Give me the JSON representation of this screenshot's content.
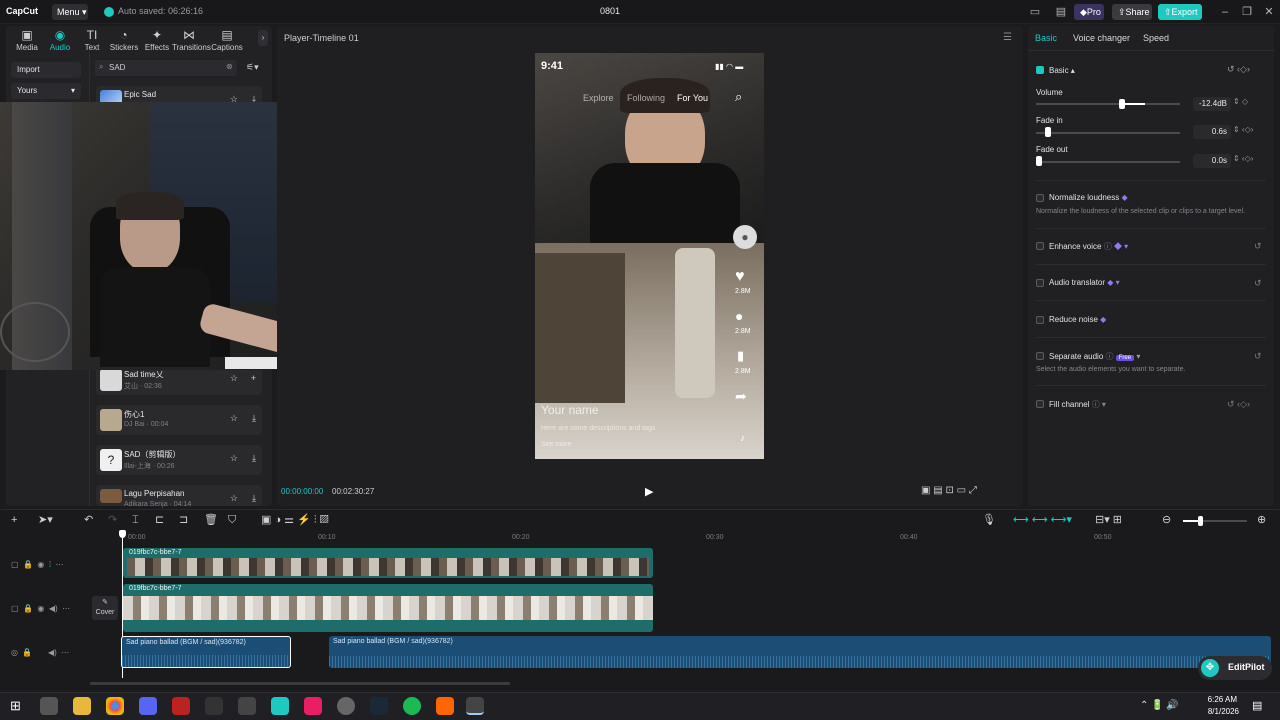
{
  "titlebar": {
    "logo": "CapCut",
    "menu": "Menu",
    "autosave": "Auto saved: 06:26:16",
    "project": "0801",
    "pro": "Pro",
    "share": "Share",
    "export": "Export"
  },
  "toolbar_tabs": [
    {
      "label": "Media",
      "icon": "▣"
    },
    {
      "label": "Audio",
      "icon": "◉"
    },
    {
      "label": "Text",
      "icon": "TI"
    },
    {
      "label": "Stickers",
      "icon": "◔"
    },
    {
      "label": "Effects",
      "icon": "✦"
    },
    {
      "label": "Transitions",
      "icon": "⋈"
    },
    {
      "label": "Captions",
      "icon": "▤"
    }
  ],
  "sidebar": {
    "import": "Import",
    "yours": "Yours"
  },
  "search": {
    "value": "SAD"
  },
  "tracks": [
    {
      "name": "Epic Sad",
      "sub": ""
    },
    {
      "name": "Sad time乂",
      "sub": "艾山 · 02:36"
    },
    {
      "name": "伤心1",
      "sub": "DJ Bai · 00:04"
    },
    {
      "name": "SAD（剪辑版）",
      "sub": "Illai-上海 · 00:26"
    },
    {
      "name": "Lagu Perpisahan",
      "sub": "Adikara Senja · 04:14"
    }
  ],
  "player": {
    "title": "Player-Timeline 01",
    "current": "00:00:00:00",
    "duration": "00:02:30:27"
  },
  "phone": {
    "time": "9:41",
    "explore": "Explore",
    "following": "Following",
    "foryou": "For You",
    "likes": "2.8M",
    "comments": "2.8M",
    "saves": "2.8M",
    "your_name": "Your name",
    "caption": "Here are some descriptions and tags",
    "see_more": "See more"
  },
  "right_panel": {
    "tabs": [
      "Basic",
      "Voice changer",
      "Speed"
    ],
    "basic_title": "Basic",
    "volume_label": "Volume",
    "volume_value": "-12.4dB",
    "fadein_label": "Fade in",
    "fadein_value": "0.6s",
    "fadeout_label": "Fade out",
    "fadeout_value": "0.0s",
    "normalize": "Normalize loudness",
    "normalize_desc": "Normalize the loudness of the selected clip or clips to a target level.",
    "enhance": "Enhance voice",
    "translator": "Audio translator",
    "noise": "Reduce noise",
    "separate": "Separate audio",
    "separate_badge": "Free",
    "separate_desc": "Select the audio elements you want to separate.",
    "fill": "Fill channel"
  },
  "timeline": {
    "ruler": [
      "00:00",
      "00:10",
      "00:20",
      "00:30",
      "00:40",
      "00:50"
    ],
    "cover": "Cover",
    "video_label_a": "019fbc7c-bbe7-7",
    "video_label_b": "019fbc7c-bbe7-7",
    "audio1": "Sad piano ballad (BGM / sad)(936782)",
    "audio2": "Sad piano ballad (BGM / sad)(936782)"
  },
  "editpilot": "EditPilot",
  "taskbar": {
    "time": "6:26 AM",
    "date": "8/1/2026"
  }
}
